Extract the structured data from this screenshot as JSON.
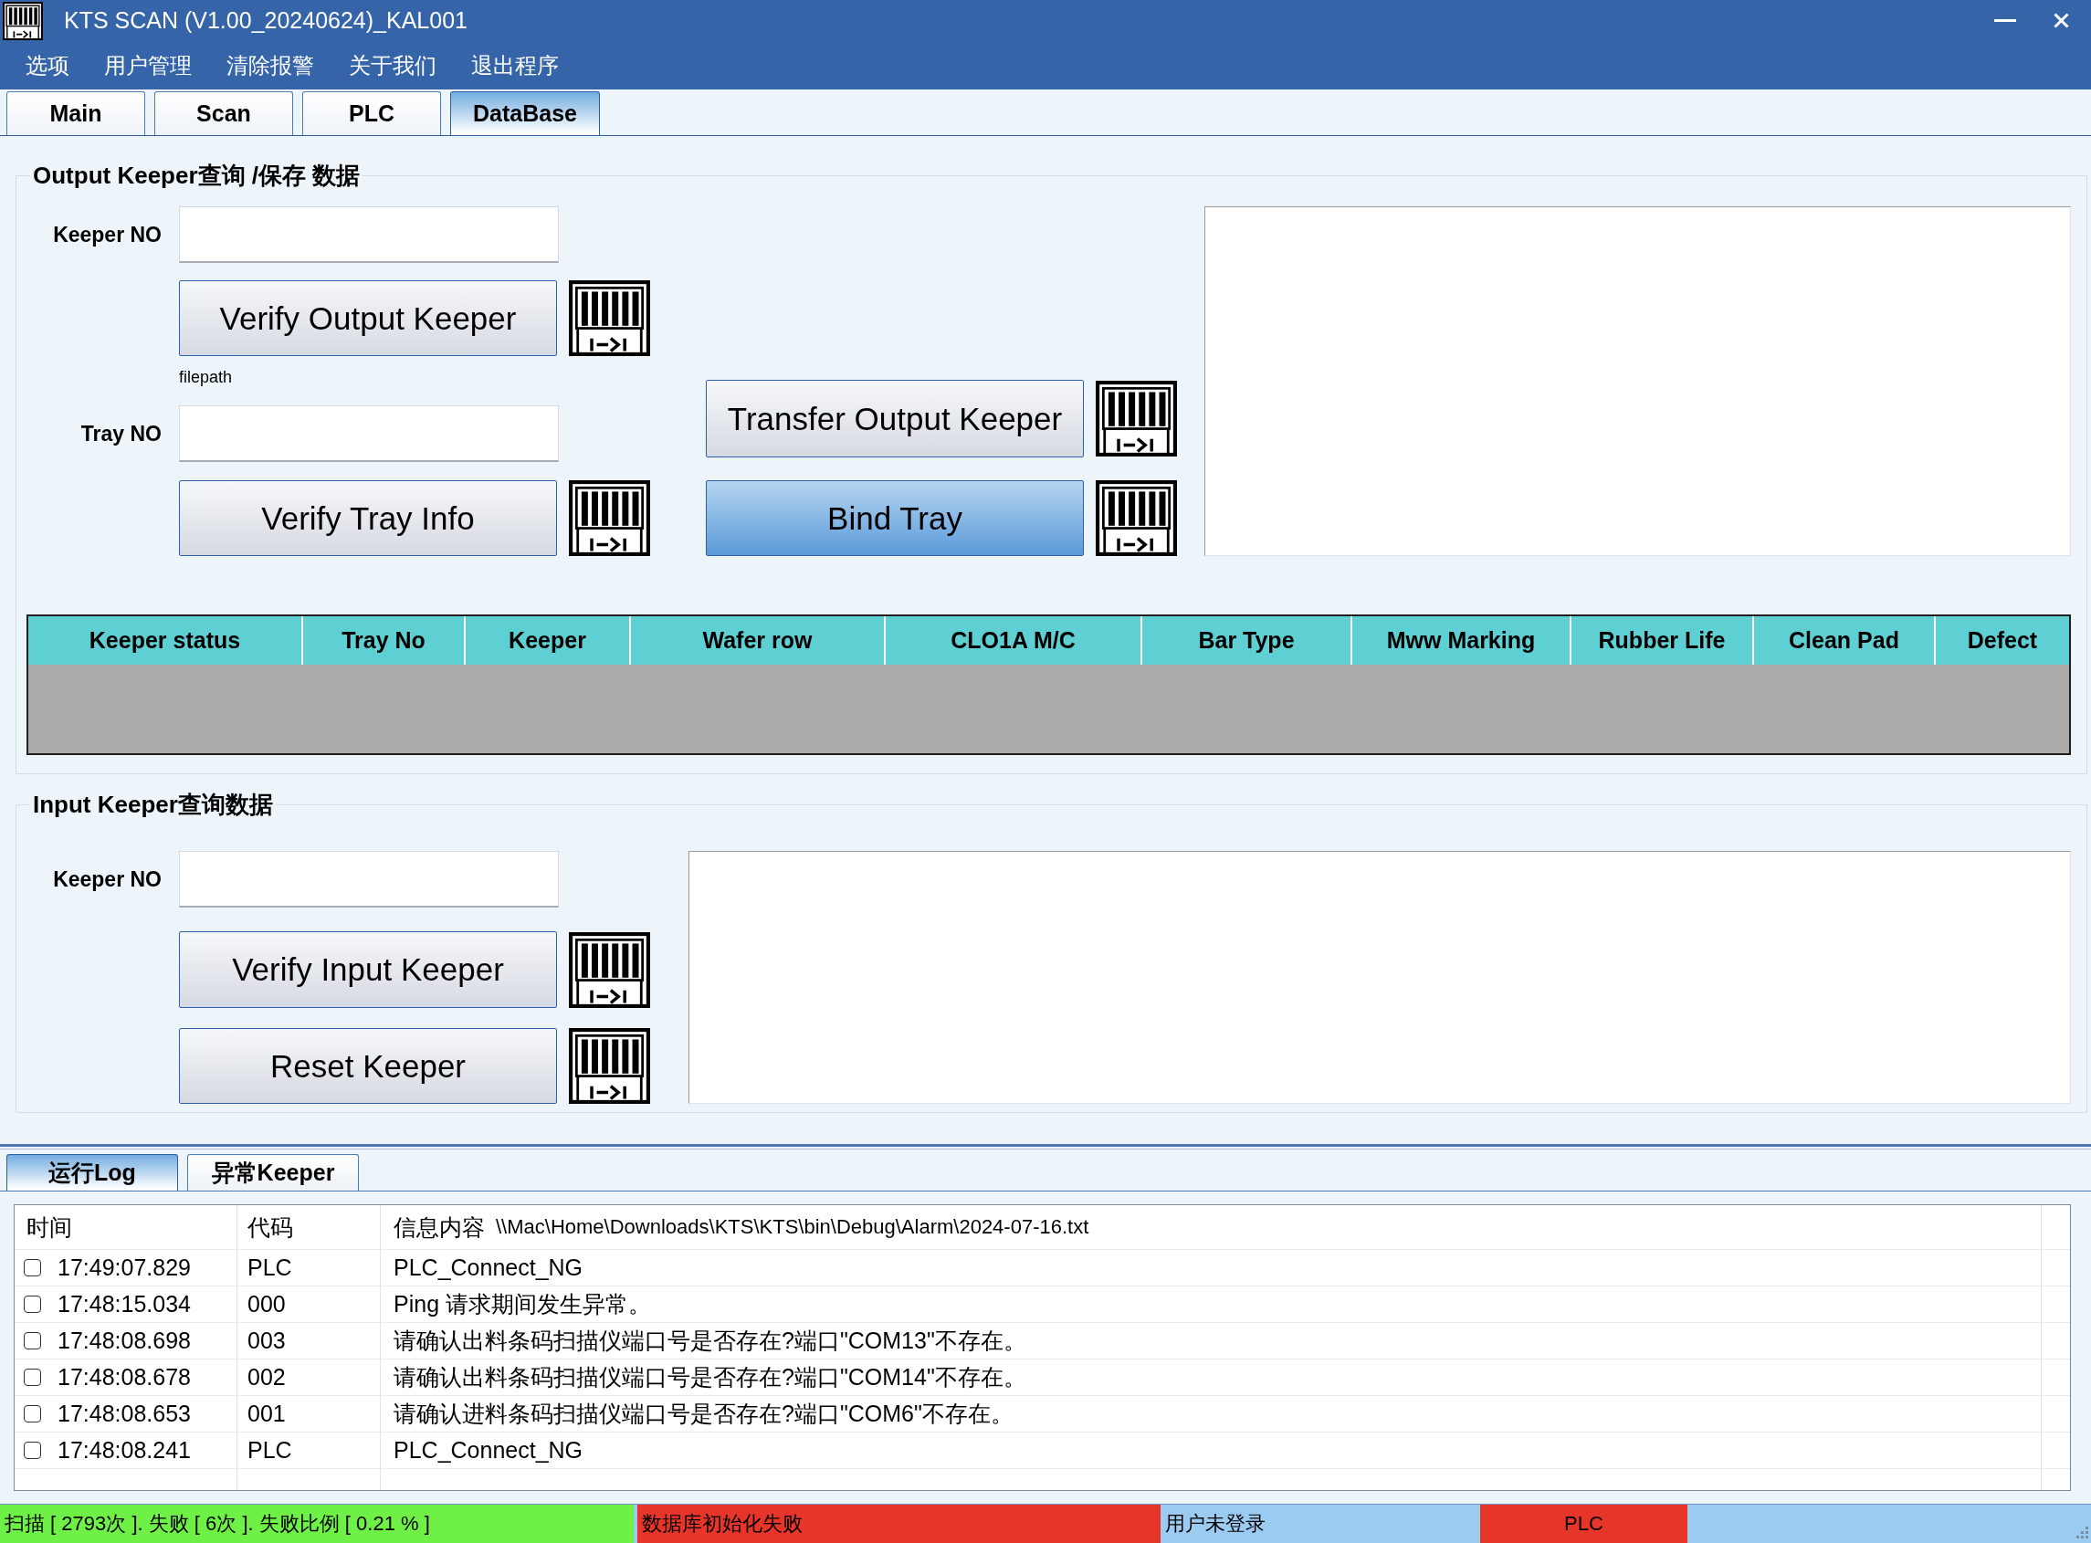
{
  "window": {
    "title": "KTS SCAN (V1.00_20240624)_KAL001"
  },
  "menu": [
    "选项",
    "用户管理",
    "清除报警",
    "关于我们",
    "退出程序"
  ],
  "tabs": [
    {
      "label": "Main",
      "selected": false
    },
    {
      "label": "Scan",
      "selected": false
    },
    {
      "label": "PLC",
      "selected": false
    },
    {
      "label": "DataBase",
      "selected": true
    }
  ],
  "output_keeper": {
    "title": "Output Keeper查询 /保存 数据",
    "keeper_no_label": "Keeper NO",
    "verify_button": {
      "label": "Verify Output Keeper",
      "focused": false
    },
    "filepath_label": "filepath",
    "tray_no_label": "Tray NO",
    "verify_tray_button": {
      "label": "Verify Tray Info",
      "focused": false
    },
    "transfer_button": {
      "label": "Transfer Output Keeper",
      "focused": false
    },
    "bind_button": {
      "label": "Bind Tray",
      "focused": true
    },
    "table": {
      "columns": [
        "Keeper status",
        "Tray No",
        "Keeper",
        "Wafer row",
        "CLO1A M/C",
        "Bar Type",
        "Mww Marking",
        "Rubber Life",
        "Clean Pad",
        "Defect"
      ]
    }
  },
  "input_keeper": {
    "title": "Input Keeper查询数据",
    "keeper_no_label": "Keeper NO",
    "verify_button": {
      "label": "Verify Input Keeper",
      "focused": false
    },
    "reset_button": {
      "label": "Reset Keeper",
      "focused": false
    }
  },
  "log_tabs": [
    {
      "label": "运行Log",
      "selected": true
    },
    {
      "label": "异常Keeper",
      "selected": false
    }
  ],
  "log": {
    "columns": [
      "时间",
      "代码",
      "信息内容"
    ],
    "file_path": "\\\\Mac\\Home\\Downloads\\KTS\\KTS\\bin\\Debug\\Alarm\\2024-07-16.txt",
    "rows": [
      {
        "checked": false,
        "time": "17:49:07.829",
        "code": "PLC",
        "message": "PLC_Connect_NG"
      },
      {
        "checked": false,
        "time": "17:48:15.034",
        "code": "000",
        "message": "Ping 请求期间发生异常。"
      },
      {
        "checked": false,
        "time": "17:48:08.698",
        "code": "003",
        "message": "请确认出料条码扫描仪端口号是否存在?端口\"COM13\"不存在。"
      },
      {
        "checked": false,
        "time": "17:48:08.678",
        "code": "002",
        "message": "请确认出料条码扫描仪端口号是否存在?端口\"COM14\"不存在。"
      },
      {
        "checked": false,
        "time": "17:48:08.653",
        "code": "001",
        "message": "请确认进料条码扫描仪端口号是否存在?端口\"COM6\"不存在。"
      },
      {
        "checked": false,
        "time": "17:48:08.241",
        "code": "PLC",
        "message": "PLC_Connect_NG"
      }
    ]
  },
  "status_bar": [
    {
      "text": "扫描 [ 2793次 ]. 失败 [ 6次 ]. 失败比例 [ 0.21 % ]",
      "color": "#6ef046"
    },
    {
      "text": "数据库初始化失败",
      "color": "#e8352a"
    },
    {
      "text": "用户未登录",
      "color": "#9ccbf2"
    },
    {
      "text": "PLC",
      "color": "#e8352a"
    }
  ]
}
